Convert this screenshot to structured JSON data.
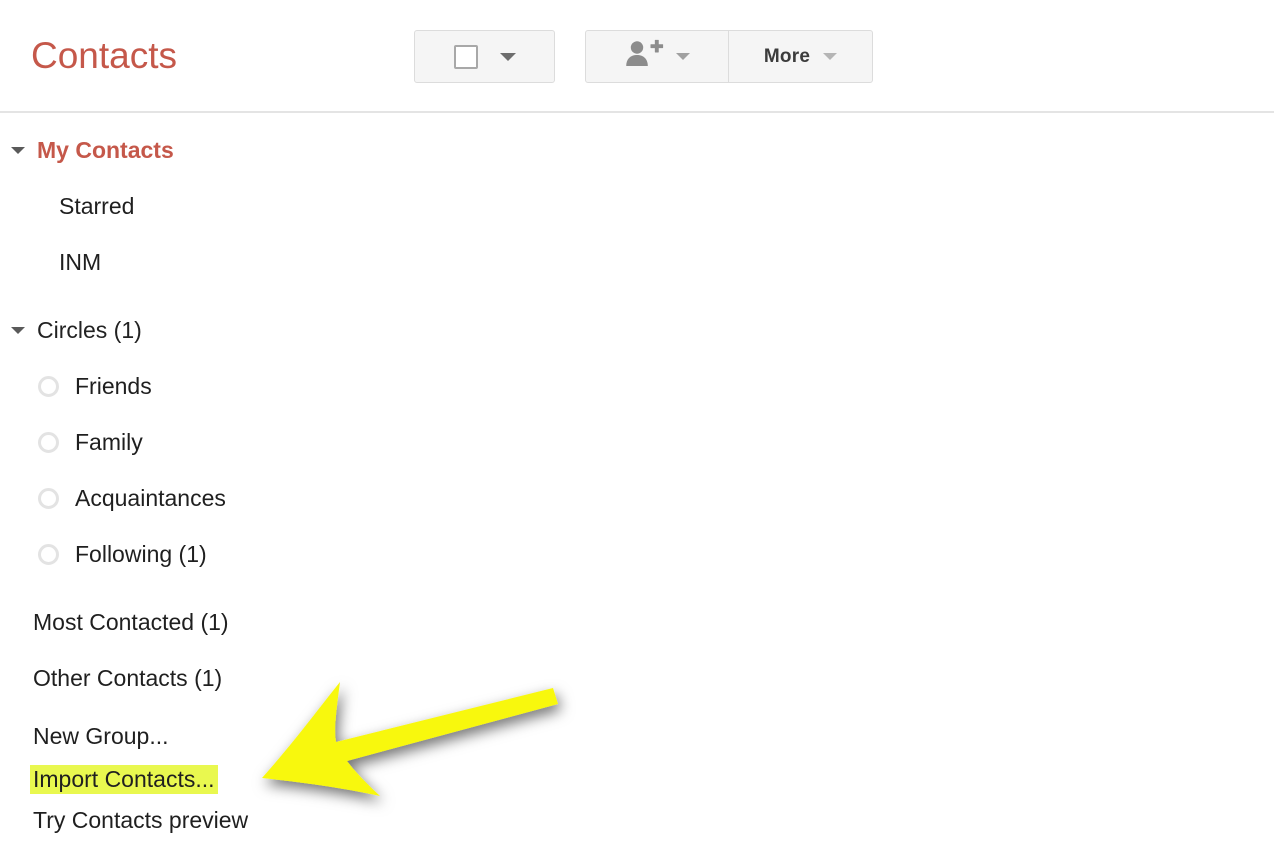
{
  "header": {
    "title": "Contacts",
    "toolbar": {
      "select_all": {
        "name": "select-all-dropdown",
        "checkbox_state": "unchecked",
        "caret": "chevron-down"
      },
      "add_contact": {
        "label": "",
        "icon": "person-add-icon",
        "caret": "chevron-down"
      },
      "more": {
        "label": "More",
        "caret": "chevron-down"
      }
    }
  },
  "sidebar": {
    "groups": [
      {
        "label": "My Contacts",
        "expanded": true,
        "accent": true,
        "items": [
          {
            "label": "Starred"
          },
          {
            "label": "INM"
          }
        ]
      },
      {
        "label": "Circles (1)",
        "expanded": true,
        "accent": false,
        "items": [
          {
            "label": "Friends",
            "icon": "circle-ring-icon"
          },
          {
            "label": "Family",
            "icon": "circle-ring-icon"
          },
          {
            "label": "Acquaintances",
            "icon": "circle-ring-icon"
          },
          {
            "label": "Following (1)",
            "icon": "circle-ring-icon"
          }
        ]
      }
    ],
    "standalone": [
      {
        "label": "Most Contacted (1)",
        "highlighted": false
      },
      {
        "label": "Other Contacts (1)",
        "highlighted": false
      }
    ],
    "actions": [
      {
        "label": "New Group...",
        "highlighted": false
      },
      {
        "label": "Import Contacts...",
        "highlighted": true
      },
      {
        "label": "Try Contacts preview",
        "highlighted": false
      }
    ]
  },
  "annotation": {
    "type": "arrow",
    "direction": "left",
    "color": "#f8f80c",
    "points_to": "Import Contacts..."
  },
  "colors": {
    "accent_red": "#c5584a",
    "highlight_yellow": "#e9f84f",
    "arrow_yellow": "#f8f80c",
    "text_dark": "#1f1f1f",
    "button_face": "#f5f5f5",
    "button_border": "#dcdcdc",
    "divider": "#e4e4e4"
  }
}
